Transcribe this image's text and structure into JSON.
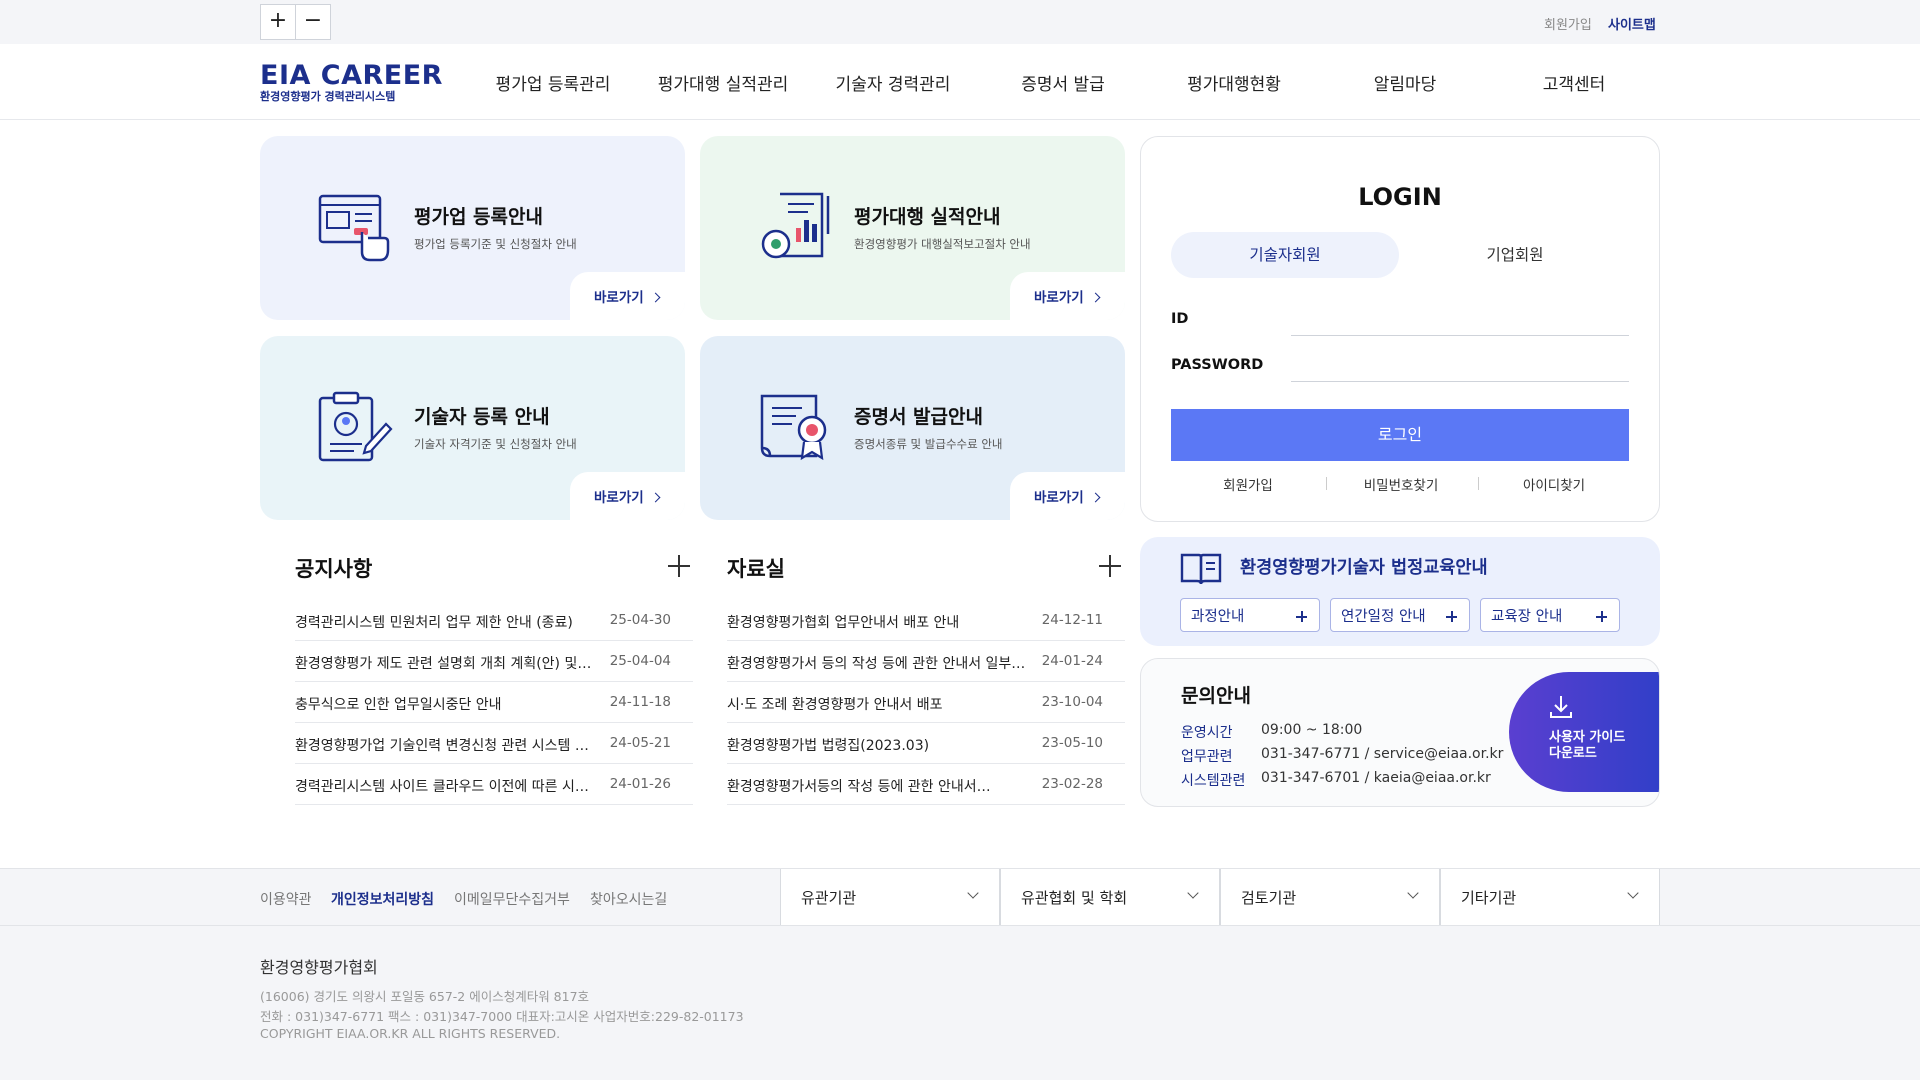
{
  "topbar": {
    "zoom_in": "+",
    "zoom_out": "−",
    "signup": "회원가입",
    "sitemap": "사이트맵"
  },
  "header": {
    "logo_main": "EIA CAREER",
    "logo_sub": "환경영향평가 경력관리시스템",
    "nav": [
      "평가업 등록관리",
      "평가대행 실적관리",
      "기술자 경력관리",
      "증명서 발급",
      "평가대행현황",
      "알림마당",
      "고객센터"
    ]
  },
  "cards": [
    {
      "title": "평가업 등록안내",
      "desc": "평가업 등록기준 및 신청절차 안내",
      "go": "바로가기",
      "bg": "#eef2fc",
      "icon": "registration-screen-icon"
    },
    {
      "title": "평가대행 실적안내",
      "desc": "환경영향평가 대행실적보고절차 안내",
      "go": "바로가기",
      "bg": "#ecf7ef",
      "icon": "performance-report-icon"
    },
    {
      "title": "기술자 등록 안내",
      "desc": "기술자 자격기준 및 신청절차 안내",
      "go": "바로가기",
      "bg": "#e9f4f8",
      "icon": "engineer-clipboard-icon"
    },
    {
      "title": "증명서 발급안내",
      "desc": "증명서종류 및 발급수수료 안내",
      "go": "바로가기",
      "bg": "#e4eef8",
      "icon": "certificate-scroll-icon"
    }
  ],
  "login": {
    "title": "LOGIN",
    "tabs": [
      "기술자회원",
      "기업회원"
    ],
    "id_label": "ID",
    "password_label": "PASSWORD",
    "id_value": "",
    "password_value": "",
    "button": "로그인",
    "links": [
      "회원가입",
      "비밀번호찾기",
      "아이디찾기"
    ]
  },
  "notice": {
    "title": "공지사항",
    "rows": [
      {
        "title": "경력관리시스템 민원처리 업무 제한 안내 (종료)",
        "date": "25-04-30"
      },
      {
        "title": "환경영향평가 제도 관련 설명회 개최 계획(안) 및 ...",
        "date": "25-04-04"
      },
      {
        "title": "충무식으로 인한 업무일시중단 안내",
        "date": "24-11-18"
      },
      {
        "title": "환경영향평가업 기술인력 변경신청 관련 시스템 …",
        "date": "24-05-21"
      },
      {
        "title": "경력관리시스템 사이트 클라우드 이전에 따른 시…",
        "date": "24-01-26"
      }
    ]
  },
  "archive": {
    "title": "자료실",
    "rows": [
      {
        "title": "환경영향평가협회 업무안내서 배포 안내",
        "date": "24-12-11"
      },
      {
        "title": "환경영향평가서 등의 작성 등에 관한 안내서 일부…",
        "date": "24-01-24"
      },
      {
        "title": "시·도 조례 환경영향평가 안내서 배포",
        "date": "23-10-04"
      },
      {
        "title": "환경영향평가법 법령집(2023.03)",
        "date": "23-05-10"
      },
      {
        "title": "환경영향평가서등의 작성 등에 관한 안내서…",
        "date": "23-02-28"
      }
    ]
  },
  "edu": {
    "title": "환경영향평가기술자 법정교육안내",
    "buttons": [
      "과정안내",
      "연간일정 안내",
      "교육장 안내"
    ]
  },
  "inquiry": {
    "title": "문의안내",
    "rows": [
      {
        "label": "운영시간",
        "value": "09:00 ~ 18:00"
      },
      {
        "label": "업무관련",
        "value": "031-347-6771 / service@eiaa.or.kr"
      },
      {
        "label": "시스템관련",
        "value": "031-347-6701 / kaeia@eiaa.or.kr"
      }
    ],
    "guide_line1": "사용자 가이드",
    "guide_line2": "다운로드"
  },
  "footer": {
    "links": [
      "이용약관",
      "개인정보처리방침",
      "이메일무단수집거부",
      "찾아오시는길"
    ],
    "selects": [
      "유관기관",
      "유관협회 및 학회",
      "검토기관",
      "기타기관"
    ],
    "org": "환경영향평가협회",
    "address": "(16006) 경기도 의왕시 포일동 657-2 에이스청계타워 817호",
    "contact": "전화 : 031)347-6771 팩스 : 031)347-7000 대표자:고시온 사업자번호:229-82-01173",
    "copyright": "COPYRIGHT EIAA.OR.KR ALL RIGHTS RESERVED."
  },
  "colors": {
    "brand": "#1c2f8c",
    "login_button": "#5b78f5",
    "page_bg": "#ffffff",
    "footer_bg": "#f4f5f8"
  }
}
